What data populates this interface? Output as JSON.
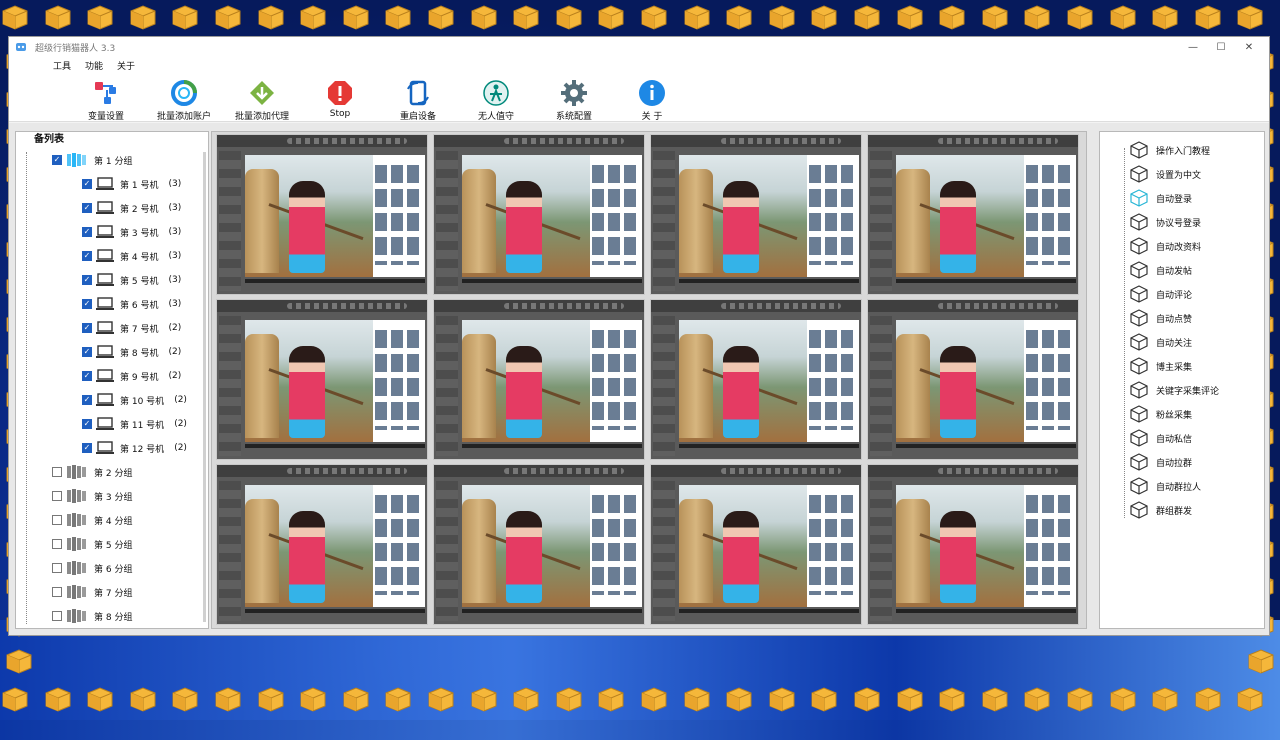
{
  "window": {
    "title": "超级行销猫器人 3.3"
  },
  "menu": [
    "工具",
    "功能",
    "关于"
  ],
  "toolbar": [
    {
      "label": "变量设置",
      "icon": "variable-settings-icon"
    },
    {
      "label": "批量添加账户",
      "icon": "add-account-icon"
    },
    {
      "label": "批量添加代理",
      "icon": "add-proxy-icon"
    },
    {
      "label": "Stop",
      "icon": "stop-icon"
    },
    {
      "label": "重启设备",
      "icon": "restart-device-icon"
    },
    {
      "label": "无人值守",
      "icon": "unattended-icon"
    },
    {
      "label": "系统配置",
      "icon": "gear-icon"
    },
    {
      "label": "关 于",
      "icon": "info-icon"
    }
  ],
  "tree": {
    "header": "备列表",
    "group1": "第 1 分组",
    "devices": [
      {
        "label": "第 1 号机",
        "count": "(3)"
      },
      {
        "label": "第 2 号机",
        "count": "(3)"
      },
      {
        "label": "第 3 号机",
        "count": "(3)"
      },
      {
        "label": "第 4 号机",
        "count": "(3)"
      },
      {
        "label": "第 5 号机",
        "count": "(3)"
      },
      {
        "label": "第 6 号机",
        "count": "(3)"
      },
      {
        "label": "第 7 号机",
        "count": "(2)"
      },
      {
        "label": "第 8 号机",
        "count": "(2)"
      },
      {
        "label": "第 9 号机",
        "count": "(2)"
      },
      {
        "label": "第 10 号机",
        "count": "(2)"
      },
      {
        "label": "第 11 号机",
        "count": "(2)"
      },
      {
        "label": "第 12 号机",
        "count": "(2)"
      }
    ],
    "groups": [
      "第 2 分组",
      "第 3 分组",
      "第 4 分组",
      "第 5 分组",
      "第 6 分组",
      "第 7 分组",
      "第 8 分组"
    ]
  },
  "functions": [
    "操作入门教程",
    "设置为中文",
    "自动登录",
    "协议号登录",
    "自动改资料",
    "自动发帖",
    "自动评论",
    "自动点赞",
    "自动关注",
    "博主采集",
    "关键字采集评论",
    "粉丝采集",
    "自动私信",
    "自动拉群",
    "自动群拉人",
    "群组群发"
  ],
  "colors": {
    "accent": "#1f5fbf",
    "frame_gold": "#f5b73a",
    "stop_red": "#e53935",
    "add_green": "#43a047"
  }
}
